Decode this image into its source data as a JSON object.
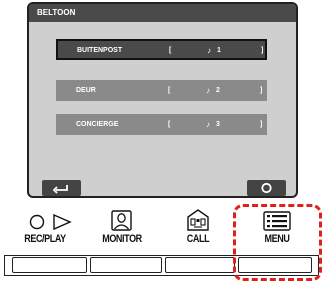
{
  "screen": {
    "title": "BELTOON",
    "options": [
      {
        "label": "BUITENPOST",
        "left_bracket": "[",
        "note": "♪",
        "number": "1",
        "right_bracket": "]",
        "selected": true
      },
      {
        "label": "DEUR",
        "left_bracket": "[",
        "note": "♪",
        "number": "2",
        "right_bracket": "]",
        "selected": false
      },
      {
        "label": "CONCIERGE",
        "left_bracket": "[",
        "note": "♪",
        "number": "3",
        "right_bracket": "]",
        "selected": false
      }
    ],
    "back_icon": "return-arrow-icon",
    "confirm_icon": "circle-icon"
  },
  "buttons": {
    "rec_play_label": "REC/PLAY",
    "monitor_label": "MONITOR",
    "call_label": "CALL",
    "menu_label": "MENU",
    "rec_play_icon": "circle-play-icon",
    "monitor_icon": "person-icon",
    "call_icon": "building-icon",
    "menu_icon": "menu-list-icon"
  },
  "colors": {
    "screen_bg": "#cfcfcf",
    "header_bg": "#4a4a4a",
    "option_bg": "#8a8a8a",
    "selected_bg": "#4a4a4a",
    "highlight": "#e0201c"
  }
}
